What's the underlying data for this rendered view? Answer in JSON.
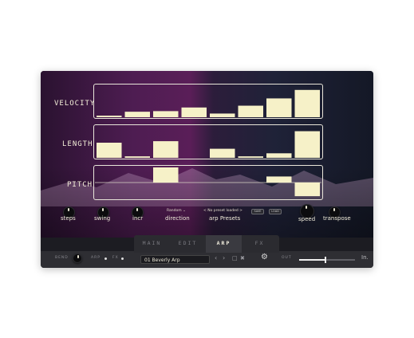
{
  "rows": {
    "velocity_label": "VELOCITY",
    "length_label": "LENGTH",
    "pitch_label": "PITCH"
  },
  "sequence": {
    "velocity": [
      0.05,
      0.18,
      0.2,
      0.32,
      0.12,
      0.38,
      0.62,
      0.9
    ],
    "length": [
      0.5,
      0.05,
      0.55,
      0,
      0.3,
      0.05,
      0.15,
      0.88
    ],
    "pitch": [
      0,
      0,
      1,
      0,
      0,
      0,
      0.4,
      -0.9
    ]
  },
  "controls": {
    "steps": "steps",
    "swing": "swing",
    "incr": "incr",
    "direction_value": "Random",
    "direction": "direction",
    "preset_status": "No preset loaded",
    "arp_presets": "arp Presets",
    "save_btn": "SAVE",
    "load_btn": "LOAD",
    "speed": "speed",
    "transpose": "transpose"
  },
  "tabs": [
    "MAIN",
    "EDIT",
    "ARP",
    "FX"
  ],
  "active_tab": "ARP",
  "bottom": {
    "bend": "BEND",
    "arp": "ARP",
    "fx": "FX",
    "preset_name": "01 Beverly Arp",
    "out": "OUT",
    "out_level": 0.45,
    "logo": "In."
  },
  "colors": {
    "bar": "#f6f1c8",
    "line": "#d8d4c4"
  }
}
